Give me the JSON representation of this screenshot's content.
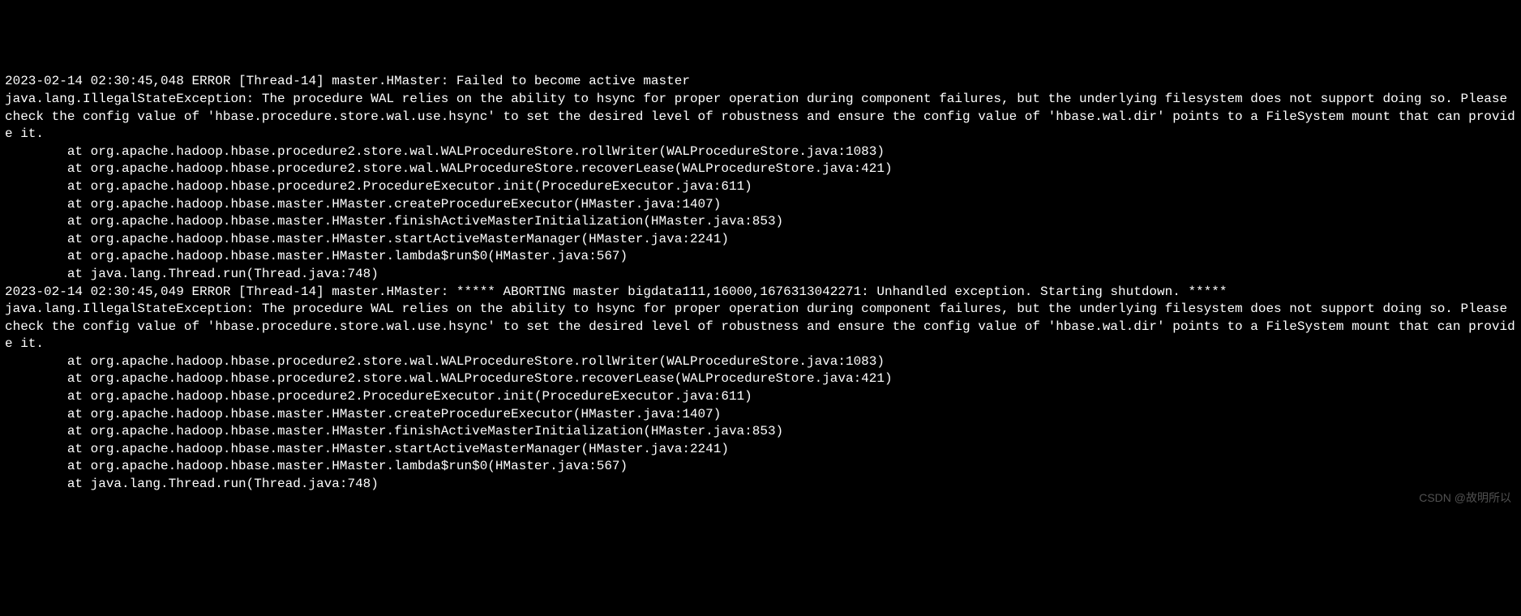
{
  "log": {
    "lines": [
      "2023-02-14 02:30:45,048 ERROR [Thread-14] master.HMaster: Failed to become active master",
      "java.lang.IllegalStateException: The procedure WAL relies on the ability to hsync for proper operation during component failures, but the underlying filesystem does not support doing so. Please check the config value of 'hbase.procedure.store.wal.use.hsync' to set the desired level of robustness and ensure the config value of 'hbase.wal.dir' points to a FileSystem mount that can provide it.",
      "        at org.apache.hadoop.hbase.procedure2.store.wal.WALProcedureStore.rollWriter(WALProcedureStore.java:1083)",
      "        at org.apache.hadoop.hbase.procedure2.store.wal.WALProcedureStore.recoverLease(WALProcedureStore.java:421)",
      "        at org.apache.hadoop.hbase.procedure2.ProcedureExecutor.init(ProcedureExecutor.java:611)",
      "        at org.apache.hadoop.hbase.master.HMaster.createProcedureExecutor(HMaster.java:1407)",
      "        at org.apache.hadoop.hbase.master.HMaster.finishActiveMasterInitialization(HMaster.java:853)",
      "        at org.apache.hadoop.hbase.master.HMaster.startActiveMasterManager(HMaster.java:2241)",
      "        at org.apache.hadoop.hbase.master.HMaster.lambda$run$0(HMaster.java:567)",
      "        at java.lang.Thread.run(Thread.java:748)",
      "2023-02-14 02:30:45,049 ERROR [Thread-14] master.HMaster: ***** ABORTING master bigdata111,16000,1676313042271: Unhandled exception. Starting shutdown. *****",
      "java.lang.IllegalStateException: The procedure WAL relies on the ability to hsync for proper operation during component failures, but the underlying filesystem does not support doing so. Please check the config value of 'hbase.procedure.store.wal.use.hsync' to set the desired level of robustness and ensure the config value of 'hbase.wal.dir' points to a FileSystem mount that can provide it.",
      "        at org.apache.hadoop.hbase.procedure2.store.wal.WALProcedureStore.rollWriter(WALProcedureStore.java:1083)",
      "        at org.apache.hadoop.hbase.procedure2.store.wal.WALProcedureStore.recoverLease(WALProcedureStore.java:421)",
      "        at org.apache.hadoop.hbase.procedure2.ProcedureExecutor.init(ProcedureExecutor.java:611)",
      "        at org.apache.hadoop.hbase.master.HMaster.createProcedureExecutor(HMaster.java:1407)",
      "        at org.apache.hadoop.hbase.master.HMaster.finishActiveMasterInitialization(HMaster.java:853)",
      "        at org.apache.hadoop.hbase.master.HMaster.startActiveMasterManager(HMaster.java:2241)",
      "        at org.apache.hadoop.hbase.master.HMaster.lambda$run$0(HMaster.java:567)",
      "        at java.lang.Thread.run(Thread.java:748)"
    ]
  },
  "watermark": "CSDN @故明所以"
}
